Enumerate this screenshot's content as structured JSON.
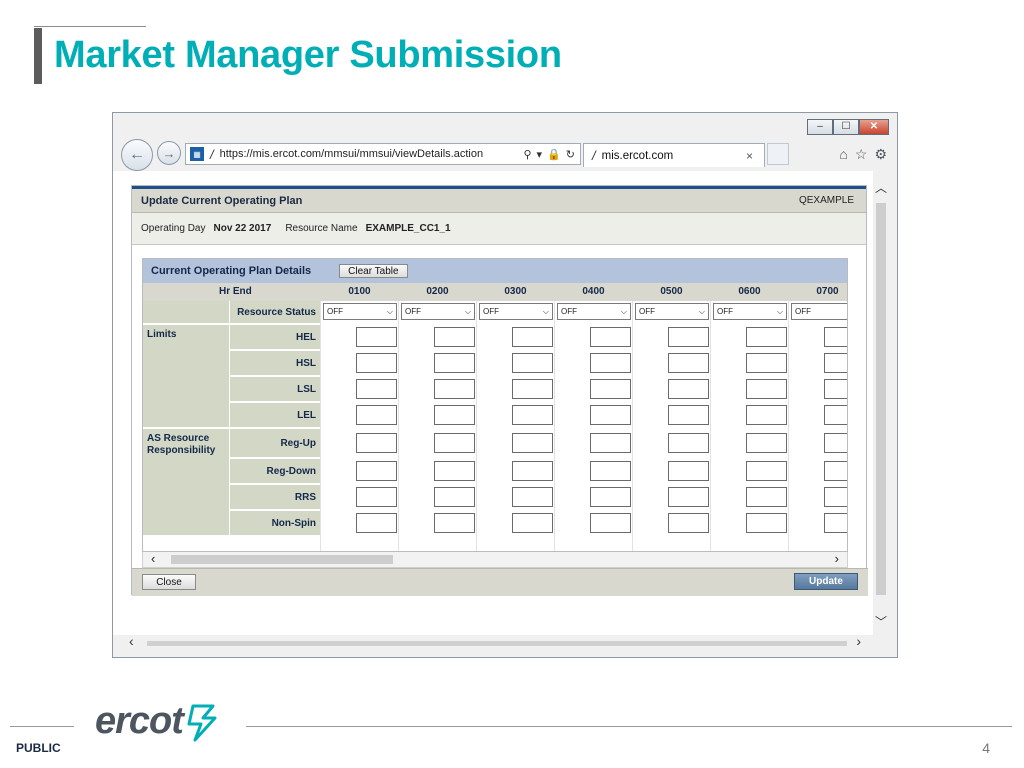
{
  "slide": {
    "title": "Market Manager Submission",
    "footer_label": "PUBLIC",
    "page_number": "4",
    "logo_text": "ercot"
  },
  "browser": {
    "address_url": "https://mis.ercot.com/mmsui/mmsui/viewDetails.action",
    "tab_title": "mis.ercot.com",
    "tab_close": "×",
    "window_buttons": {
      "minimize": "–",
      "maximize": "☐",
      "close": "✕"
    },
    "nav": {
      "back": "←",
      "forward": "→"
    },
    "icons": [
      "home-icon",
      "star-icon",
      "gear-icon"
    ]
  },
  "app": {
    "header_title": "Update Current Operating Plan",
    "user": "QEXAMPLE",
    "operating_day_label": "Operating Day",
    "operating_day_value": "Nov 22 2017",
    "resource_name_label": "Resource Name",
    "resource_name_value": "EXAMPLE_CC1_1",
    "grid_title": "Current Operating Plan Details",
    "clear_table_label": "Clear Table",
    "hr_end_label": "Hr End",
    "hours": [
      "0100",
      "0200",
      "0300",
      "0400",
      "0500",
      "0600",
      "0700"
    ],
    "resource_status_label": "Resource Status",
    "resource_status_values": [
      "OFF",
      "OFF",
      "OFF",
      "OFF",
      "OFF",
      "OFF",
      "OFF"
    ],
    "groups": [
      {
        "label": "Limits",
        "rows": [
          "HEL",
          "HSL",
          "LSL",
          "LEL"
        ]
      },
      {
        "label": "AS Resource Responsibility",
        "rows": [
          "Reg-Up",
          "Reg-Down",
          "RRS",
          "Non-Spin"
        ]
      }
    ],
    "close_label": "Close",
    "update_label": "Update"
  }
}
